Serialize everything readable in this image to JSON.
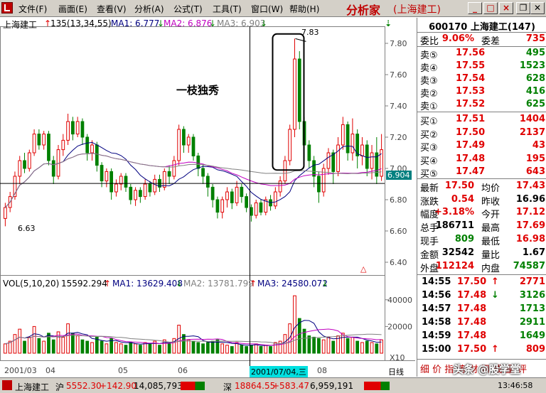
{
  "menubar": {
    "items": [
      "文件(F)",
      "画面(E)",
      "查看(V)",
      "分析(A)",
      "公式(T)",
      "工具(T)",
      "窗口(W)",
      "帮助(H)"
    ],
    "brand": "分析家",
    "brand_sub": "(上海建工)",
    "window_buttons": [
      "_",
      "□",
      "×"
    ]
  },
  "chart_header": {
    "stock_name": "上海建工",
    "period_info": "135(13,34,55)",
    "ma1_label": "MA1: 6.777",
    "ma2_label": "MA2: 6.876",
    "ma3_label": "MA3: 6.903",
    "annotation": "一枝独秀",
    "peak_label": "7.83",
    "low_label": "6.63",
    "current_price_tag": "6.904"
  },
  "volume_header": {
    "label": "VOL(5,10,20)",
    "value": "15592.294",
    "ma1": "MA1: 13629.408",
    "ma2": "MA2: 13781.799",
    "ma3": "MA3: 24580.072"
  },
  "date_axis": {
    "labels": [
      "2001/03",
      "04",
      "05",
      "06",
      "08"
    ],
    "cursor_date": "2001/07/04,三",
    "period_tab": "日线",
    "x10": "X10"
  },
  "chart_data": {
    "type": "candlestick",
    "price_axis": {
      "ticks": [
        "7.80",
        "7.60",
        "7.40",
        "7.20",
        "7.00",
        "6.80",
        "6.60",
        "6.40"
      ],
      "range": [
        6.35,
        7.9
      ]
    },
    "volume_axis": {
      "ticks": [
        "40000",
        "20000"
      ],
      "range": [
        0,
        50000
      ]
    },
    "candles": [
      [
        6.68,
        6.75,
        6.63,
        6.78,
        7000
      ],
      [
        6.75,
        6.82,
        6.72,
        6.85,
        9000
      ],
      [
        6.82,
        6.95,
        6.8,
        6.98,
        14000
      ],
      [
        6.95,
        7.05,
        6.9,
        7.08,
        18000
      ],
      [
        7.05,
        7.0,
        6.97,
        7.1,
        9000
      ],
      [
        7.0,
        7.1,
        6.98,
        7.12,
        12000
      ],
      [
        7.1,
        7.22,
        7.08,
        7.25,
        20000
      ],
      [
        7.22,
        7.15,
        7.12,
        7.25,
        11000
      ],
      [
        7.15,
        7.22,
        7.12,
        7.24,
        9000
      ],
      [
        7.22,
        7.05,
        7.02,
        7.24,
        15000
      ],
      [
        7.05,
        6.95,
        6.9,
        7.08,
        10000
      ],
      [
        6.95,
        7.12,
        6.93,
        7.15,
        16000
      ],
      [
        7.12,
        7.18,
        7.08,
        7.22,
        12000
      ],
      [
        7.18,
        7.3,
        7.15,
        7.35,
        22000
      ],
      [
        7.3,
        7.22,
        7.18,
        7.33,
        15000
      ],
      [
        7.22,
        7.3,
        7.2,
        7.33,
        13000
      ],
      [
        7.3,
        7.2,
        7.15,
        7.32,
        10000
      ],
      [
        7.2,
        7.1,
        7.05,
        7.22,
        9000
      ],
      [
        7.1,
        7.15,
        7.05,
        7.18,
        8000
      ],
      [
        7.15,
        7.02,
        6.98,
        7.17,
        12000
      ],
      [
        7.02,
        6.92,
        6.88,
        7.04,
        9000
      ],
      [
        6.92,
        6.98,
        6.88,
        7.0,
        7000
      ],
      [
        6.98,
        6.85,
        6.8,
        7.0,
        11000
      ],
      [
        6.85,
        6.9,
        6.82,
        6.93,
        8000
      ],
      [
        6.9,
        6.95,
        6.86,
        6.97,
        7000
      ],
      [
        6.95,
        6.88,
        6.85,
        6.97,
        6000
      ],
      [
        6.88,
        6.8,
        6.77,
        6.9,
        8000
      ],
      [
        6.8,
        6.86,
        6.76,
        6.88,
        7000
      ],
      [
        6.86,
        6.82,
        6.78,
        6.88,
        6000
      ],
      [
        6.82,
        6.9,
        6.8,
        6.93,
        8000
      ],
      [
        6.9,
        6.85,
        6.82,
        6.92,
        7000
      ],
      [
        6.85,
        6.93,
        6.83,
        6.96,
        9000
      ],
      [
        6.93,
        6.88,
        6.85,
        6.96,
        6000
      ],
      [
        6.88,
        6.98,
        6.86,
        7.0,
        10000
      ],
      [
        6.98,
        6.95,
        6.9,
        7.02,
        7000
      ],
      [
        6.95,
        7.05,
        6.93,
        7.08,
        11000
      ],
      [
        7.05,
        7.25,
        7.02,
        7.28,
        21000
      ],
      [
        7.25,
        7.15,
        7.1,
        7.27,
        14000
      ],
      [
        7.15,
        7.2,
        7.1,
        7.22,
        10000
      ],
      [
        7.2,
        7.08,
        7.05,
        7.22,
        9000
      ],
      [
        7.08,
        7.0,
        6.95,
        7.1,
        8000
      ],
      [
        7.0,
        6.95,
        6.9,
        7.03,
        7000
      ],
      [
        6.95,
        6.88,
        6.82,
        6.97,
        8000
      ],
      [
        6.88,
        6.8,
        6.75,
        6.9,
        9000
      ],
      [
        6.8,
        6.72,
        6.68,
        6.82,
        10000
      ],
      [
        6.72,
        6.8,
        6.68,
        6.82,
        7000
      ],
      [
        6.8,
        6.85,
        6.75,
        6.88,
        6000
      ],
      [
        6.85,
        6.78,
        6.74,
        6.87,
        5000
      ],
      [
        6.78,
        6.88,
        6.76,
        6.92,
        8000
      ],
      [
        6.88,
        6.82,
        6.78,
        6.9,
        6000
      ],
      [
        6.82,
        6.75,
        6.72,
        6.84,
        5000
      ],
      [
        6.75,
        6.7,
        6.66,
        6.77,
        6000
      ],
      [
        6.7,
        6.78,
        6.68,
        6.8,
        7000
      ],
      [
        6.78,
        6.72,
        6.7,
        6.8,
        5000
      ],
      [
        6.72,
        6.8,
        6.7,
        6.82,
        6000
      ],
      [
        6.8,
        6.76,
        6.73,
        6.83,
        5000
      ],
      [
        6.76,
        6.85,
        6.74,
        6.88,
        8000
      ],
      [
        6.85,
        6.92,
        6.82,
        6.95,
        9000
      ],
      [
        6.92,
        7.05,
        6.9,
        7.08,
        14000
      ],
      [
        7.05,
        7.25,
        7.02,
        7.28,
        22000
      ],
      [
        7.25,
        7.7,
        7.2,
        7.83,
        43000
      ],
      [
        7.7,
        7.3,
        7.25,
        7.75,
        26000
      ],
      [
        7.3,
        7.15,
        7.05,
        7.33,
        18000
      ],
      [
        7.15,
        7.05,
        7.0,
        7.18,
        13000
      ],
      [
        7.05,
        6.95,
        6.88,
        7.08,
        12000
      ],
      [
        6.95,
        6.85,
        6.78,
        6.98,
        11000
      ],
      [
        6.85,
        7.0,
        6.82,
        7.03,
        10000
      ],
      [
        7.0,
        7.1,
        6.96,
        7.13,
        12000
      ],
      [
        7.1,
        6.98,
        6.9,
        7.12,
        9000
      ],
      [
        6.98,
        7.15,
        6.95,
        7.2,
        13000
      ],
      [
        7.15,
        7.28,
        7.12,
        7.33,
        15000
      ],
      [
        7.28,
        7.1,
        7.05,
        7.3,
        11000
      ],
      [
        7.1,
        7.22,
        7.05,
        7.32,
        12000
      ],
      [
        7.22,
        7.08,
        7.0,
        7.25,
        9000
      ],
      [
        7.08,
        7.15,
        7.02,
        7.2,
        8000
      ],
      [
        7.15,
        7.0,
        6.95,
        7.18,
        9000
      ],
      [
        7.0,
        7.1,
        6.93,
        7.15,
        8000
      ],
      [
        7.1,
        6.95,
        6.9,
        7.2,
        7000
      ],
      [
        6.95,
        7.12,
        6.92,
        7.22,
        10000
      ]
    ]
  },
  "panel": {
    "code_title": "600170 上海建工(147)",
    "weibi": {
      "label": "委比",
      "value": "9.06%",
      "label2": "委差",
      "value2": "735"
    },
    "sells": [
      {
        "label": "卖⑤",
        "price": "17.56",
        "vol": "495"
      },
      {
        "label": "卖④",
        "price": "17.55",
        "vol": "1523"
      },
      {
        "label": "卖③",
        "price": "17.54",
        "vol": "628"
      },
      {
        "label": "卖②",
        "price": "17.53",
        "vol": "416"
      },
      {
        "label": "卖①",
        "price": "17.52",
        "vol": "625"
      }
    ],
    "buys": [
      {
        "label": "买①",
        "price": "17.51",
        "vol": "1404"
      },
      {
        "label": "买②",
        "price": "17.50",
        "vol": "2137"
      },
      {
        "label": "买③",
        "price": "17.49",
        "vol": "43"
      },
      {
        "label": "买④",
        "price": "17.48",
        "vol": "195"
      },
      {
        "label": "买⑤",
        "price": "17.47",
        "vol": "643"
      }
    ],
    "stats": [
      {
        "l1": "最新",
        "v1": "17.50",
        "l2": "均价",
        "v2": "17.43",
        "c1": "red",
        "c2": "red"
      },
      {
        "l1": "涨跌",
        "v1": "0.54",
        "l2": "昨收",
        "v2": "16.96",
        "c1": "red",
        "c2": "blk"
      },
      {
        "l1": "幅度",
        "v1": "+3.18%",
        "l2": "今开",
        "v2": "17.12",
        "c1": "red",
        "c2": "red"
      },
      {
        "l1": "总手",
        "v1": "186711",
        "l2": "最高",
        "v2": "17.69",
        "c1": "blk",
        "c2": "red"
      },
      {
        "l1": "现手",
        "v1": "809",
        "l2": "最低",
        "v2": "16.98",
        "c1": "green",
        "c2": "red"
      },
      {
        "l1": "金额",
        "v1": "32542",
        "l2": "量比",
        "v2": "1.67",
        "c1": "blk",
        "c2": "blk"
      },
      {
        "l1": "外盘",
        "v1": "112124",
        "l2": "内盘",
        "v2": "74587",
        "c1": "red",
        "c2": "green"
      }
    ],
    "ticks": [
      {
        "time": "14:55",
        "price": "17.50",
        "arrow": "↑",
        "vol": "2771",
        "ac": "red",
        "vc": "red"
      },
      {
        "time": "14:56",
        "price": "17.48",
        "arrow": "↓",
        "vol": "3126",
        "ac": "green",
        "vc": "green"
      },
      {
        "time": "14:57",
        "price": "17.48",
        "arrow": "",
        "vol": "1713",
        "ac": "green",
        "vc": "green"
      },
      {
        "time": "14:58",
        "price": "17.48",
        "arrow": "",
        "vol": "2911",
        "ac": "green",
        "vc": "green"
      },
      {
        "time": "14:59",
        "price": "17.48",
        "arrow": "",
        "vol": "1649",
        "ac": "green",
        "vc": "green"
      },
      {
        "time": "15:00",
        "price": "17.50",
        "arrow": "↑",
        "vol": "809",
        "ac": "red",
        "vc": "red"
      }
    ],
    "bottom_tabs": "细 价 指 势 财 讯 成 量 评",
    "watermark": "头条 @股学堂"
  },
  "statusbar": {
    "stock": "上海建工",
    "sh_label": "沪",
    "sh_index": "5552.30",
    "sh_change": "+142.90",
    "sh_vol": "14,085,793",
    "sz_label": "深",
    "sz_index": "18864.55",
    "sz_change": "+583.47",
    "sz_vol": "6,959,191",
    "time": "13:46:58"
  },
  "colors": {
    "up": "#e00000",
    "down": "#008000",
    "ma1": "#000080",
    "ma2": "#c000c0",
    "ma3": "#808080"
  }
}
